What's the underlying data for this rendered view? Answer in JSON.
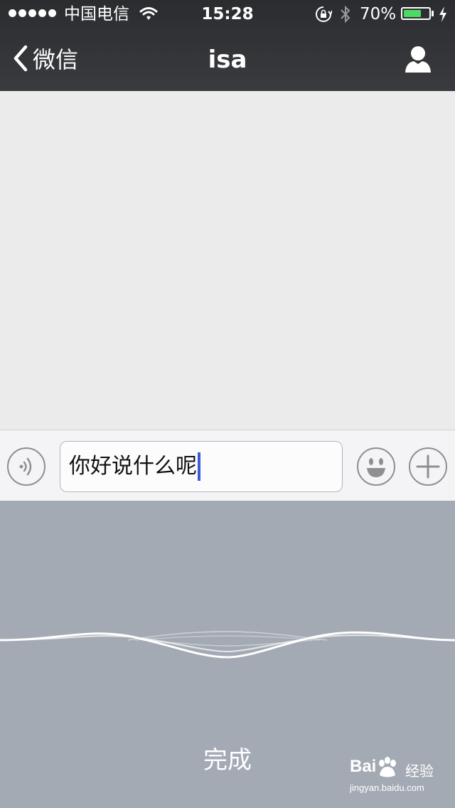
{
  "status_bar": {
    "carrier": "中国电信",
    "time": "15:28",
    "battery_percent": "70%",
    "battery_level": 0.7,
    "signal_dots": 5
  },
  "nav": {
    "back_label": "微信",
    "title": "isa"
  },
  "input_bar": {
    "text_value": "你好说什么呢"
  },
  "voice_panel": {
    "done_label": "完成"
  },
  "watermark": {
    "logo": "Bai",
    "logo_suffix": "经验",
    "url": "jingyan.baidu.com"
  },
  "colors": {
    "nav_bg": "#2f3034",
    "chat_bg": "#ebebeb",
    "voice_panel_bg": "#a4aab4",
    "battery_fill": "#4cd964",
    "cursor": "#3c5bdc"
  }
}
